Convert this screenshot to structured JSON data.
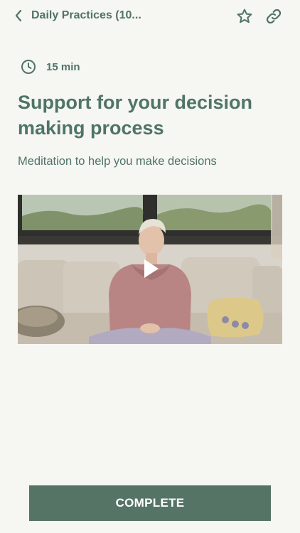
{
  "header": {
    "title": "Daily Practices (10...",
    "back_icon": "chevron-left-icon",
    "favorite_icon": "star-icon",
    "share_icon": "link-icon"
  },
  "practice": {
    "duration_icon": "clock-icon",
    "duration": "15 min",
    "title": "Support for your decision making process",
    "description": "Meditation to help you make decisions"
  },
  "video": {
    "play_icon": "play-icon"
  },
  "footer": {
    "complete_label": "COMPLETE"
  },
  "colors": {
    "background": "#f6f6f2",
    "accent_text": "#4f7468",
    "button": "#557466",
    "button_text": "#ffffff"
  }
}
